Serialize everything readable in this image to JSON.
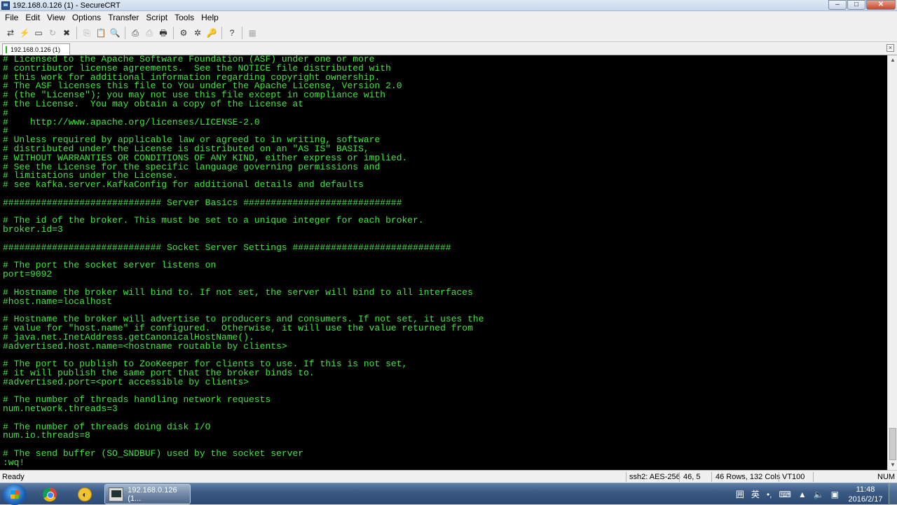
{
  "window": {
    "title": "192.168.0.126 (1) - SecureCRT",
    "controls": {
      "minimize": "–",
      "maximize": "□",
      "close": "✕"
    }
  },
  "menu": [
    "File",
    "Edit",
    "View",
    "Options",
    "Transfer",
    "Script",
    "Tools",
    "Help"
  ],
  "toolbar_icons": [
    {
      "name": "connect-icon",
      "glyph": "⇄"
    },
    {
      "name": "quick-connect-icon",
      "glyph": "⚡"
    },
    {
      "name": "connect-in-tab-icon",
      "glyph": "▭"
    },
    {
      "name": "reconnect-icon",
      "glyph": "↻",
      "dim": true
    },
    {
      "name": "disconnect-icon",
      "glyph": "✖"
    },
    {
      "name": "copy-icon",
      "glyph": "⎘",
      "dim": true
    },
    {
      "name": "paste-icon",
      "glyph": "📋"
    },
    {
      "name": "find-icon",
      "glyph": "🔍"
    },
    {
      "name": "print-icon",
      "glyph": "⎙"
    },
    {
      "name": "print-selection-icon",
      "glyph": "⎙",
      "dim": true
    },
    {
      "name": "printer-icon",
      "glyph": "🖶"
    },
    {
      "name": "session-options-icon",
      "glyph": "⚙"
    },
    {
      "name": "global-options-icon",
      "glyph": "✲"
    },
    {
      "name": "keymap-icon",
      "glyph": "🔑"
    },
    {
      "name": "help-icon",
      "glyph": "?"
    },
    {
      "name": "sftp-icon",
      "glyph": "▦",
      "dim": true
    }
  ],
  "tab": {
    "label": "192.168.0.126  (1)",
    "close": "×"
  },
  "terminal": {
    "lines": [
      "# Licensed to the Apache Software Foundation (ASF) under one or more",
      "# contributor license agreements.  See the NOTICE file distributed with",
      "# this work for additional information regarding copyright ownership.",
      "# The ASF licenses this file to You under the Apache License, Version 2.0",
      "# (the \"License\"); you may not use this file except in compliance with",
      "# the License.  You may obtain a copy of the License at",
      "#",
      "#    http://www.apache.org/licenses/LICENSE-2.0",
      "#",
      "# Unless required by applicable law or agreed to in writing, software",
      "# distributed under the License is distributed on an \"AS IS\" BASIS,",
      "# WITHOUT WARRANTIES OR CONDITIONS OF ANY KIND, either express or implied.",
      "# See the License for the specific language governing permissions and",
      "# limitations under the License.",
      "# see kafka.server.KafkaConfig for additional details and defaults",
      "",
      "############################# Server Basics #############################",
      "",
      "# The id of the broker. This must be set to a unique integer for each broker.",
      "broker.id=3",
      "",
      "############################# Socket Server Settings #############################",
      "",
      "# The port the socket server listens on",
      "port=9092",
      "",
      "# Hostname the broker will bind to. If not set, the server will bind to all interfaces",
      "#host.name=localhost",
      "",
      "# Hostname the broker will advertise to producers and consumers. If not set, it uses the",
      "# value for \"host.name\" if configured.  Otherwise, it will use the value returned from",
      "# java.net.InetAddress.getCanonicalHostName().",
      "#advertised.host.name=<hostname routable by clients>",
      "",
      "# The port to publish to ZooKeeper for clients to use. If this is not set,",
      "# it will publish the same port that the broker binds to.",
      "#advertised.port=<port accessible by clients>",
      "",
      "# The number of threads handling network requests",
      "num.network.threads=3",
      "",
      "# The number of threads doing disk I/O",
      "num.io.threads=8",
      "",
      "# The send buffer (SO_SNDBUF) used by the socket server",
      ":wq!"
    ]
  },
  "status": {
    "ready": "Ready",
    "cipher": "ssh2: AES-256",
    "cursor": "46,  5",
    "size": "46 Rows, 132 Cols",
    "emulation": "VT100",
    "num": "NUM"
  },
  "taskbar": {
    "task_label": "192.168.0.126 (1...",
    "ime_lang": "英",
    "time": "11:48",
    "date": "2016/2/17"
  }
}
